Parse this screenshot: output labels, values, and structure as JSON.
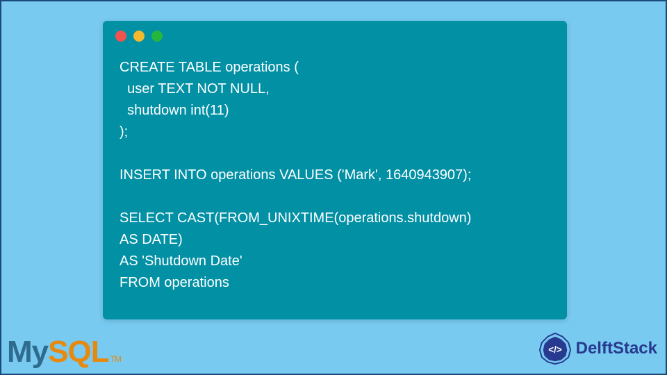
{
  "code": "CREATE TABLE operations (\n  user TEXT NOT NULL,\n  shutdown int(11)\n);\n\nINSERT INTO operations VALUES ('Mark', 1640943907);\n\nSELECT CAST(FROM_UNIXTIME(operations.shutdown)\nAS DATE)\nAS 'Shutdown Date'\nFROM operations",
  "logos": {
    "mysql_my": "My",
    "mysql_sql": "SQL",
    "mysql_tm": "TM",
    "delftstack": "DelftStack"
  }
}
